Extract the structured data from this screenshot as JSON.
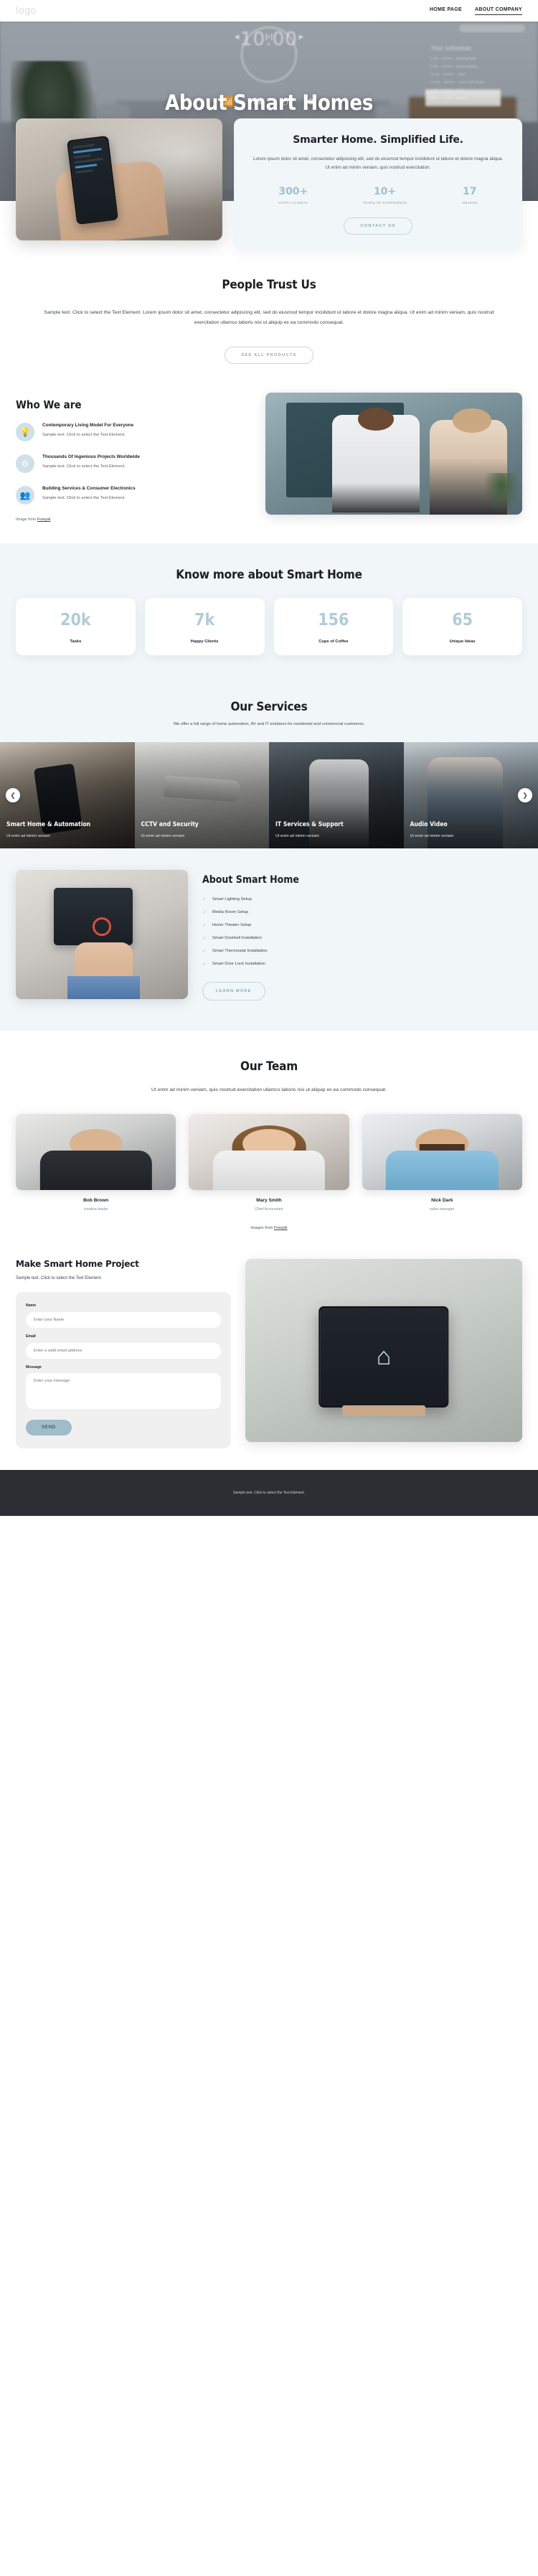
{
  "header": {
    "logo": "logo",
    "nav": [
      {
        "label": "HOME PAGE",
        "active": false
      },
      {
        "label": "ABOUT COMPANY",
        "active": true
      }
    ]
  },
  "hero": {
    "title": "About Smart Homes",
    "overlay_time": "10:00",
    "schedule_title": "Your schedule",
    "schedule": [
      {
        "time": "8 AM",
        "task": "Morning Walk"
      },
      {
        "time": "9 AM",
        "task": "Board Meeting"
      },
      {
        "time": "11 AM",
        "task": "Work"
      },
      {
        "time": "12 PM",
        "task": "Lunch with Family"
      },
      {
        "time": "2 PM",
        "task": "Work"
      },
      {
        "time": "5 PM",
        "task": "Dinner"
      }
    ],
    "phone_time": "10:00",
    "phone_labels": [
      "Wi-Fi",
      "Bluetooth"
    ],
    "controls": [
      "prev-icon",
      "pause-icon",
      "play-icon"
    ],
    "status_icons": [
      "wifi-icon",
      "bluetooth-icon",
      "power-icon",
      "settings-icon"
    ]
  },
  "hero_card": {
    "title": "Smarter Home. Simplified Life.",
    "description": "Lorem ipsum dolor sit amet, consectetur adipiscing elit, sed do eiusmod tempor incididunt ut labore et dolore magna aliqua. Ut enim ad minim veniam, quis nostrud exercitation.",
    "stats": [
      {
        "number": "300+",
        "label": "HAPPY CLIENTS"
      },
      {
        "number": "10+",
        "label": "YEARS OF EXPERIENCE"
      },
      {
        "number": "17",
        "label": "AWARDS"
      }
    ],
    "button": "CONTACT US"
  },
  "trust": {
    "title": "People Trust Us",
    "text": "Sample text. Click to select the Text Element. Lorem ipsum dolor sit amet, consectetur adipiscing elit, sed do eiusmod tempor incididunt ut labore et dolore magna aliqua. Ut enim ad minim veniam, quis nostrud exercitation ullamco laboris nisi ut aliquip ex ea commodo consequat.",
    "button": "SEE ALL PRODUCTS"
  },
  "who": {
    "title": "Who We are",
    "features": [
      {
        "icon": "lightbulb-icon",
        "title": "Contemporary Living Model For Everyone",
        "desc": "Sample text. Click to select the Text Element."
      },
      {
        "icon": "gear-icon",
        "title": "Thousands Of Ingenious Projects Worldwide",
        "desc": "Sample text. Click to select the Text Element."
      },
      {
        "icon": "people-icon",
        "title": "Building Services & Consumer Electronics",
        "desc": "Sample text. Click to select the Text Element."
      }
    ],
    "credit_prefix": "Image from ",
    "credit_link": "Freepik"
  },
  "know_more": {
    "title": "Know more about Smart Home",
    "stats": [
      {
        "number": "20k",
        "label": "Tasks"
      },
      {
        "number": "7k",
        "label": "Happy Clients"
      },
      {
        "number": "156",
        "label": "Cups of Coffee"
      },
      {
        "number": "65",
        "label": "Unique Ideas"
      }
    ]
  },
  "services": {
    "title": "Our Services",
    "subtitle": "We offer a full range of home automation, AV and IT solutions for residential and commercial customers.",
    "prev_icon": "chevron-left-icon",
    "next_icon": "chevron-right-icon",
    "items": [
      {
        "title": "Smart Home & Automation",
        "desc": "Ut enim ad minim veniam"
      },
      {
        "title": "CCTV and Security",
        "desc": "Ut enim ad minim veniam"
      },
      {
        "title": "IT Services & Support",
        "desc": "Ut enim ad minim veniam"
      },
      {
        "title": "Audio Video",
        "desc": "Ut enim ad minim veniam"
      }
    ]
  },
  "about_smart_home": {
    "title": "About Smart Home",
    "items": [
      "Smart Lighting Setup",
      "Media Room Setup",
      "Home Theater Setup",
      "Smart Doorbell Installation",
      "Smart Thermostat Installation",
      "Smart Door Lock Installation"
    ],
    "button": "LEARN MORE"
  },
  "team": {
    "title": "Our Team",
    "subtitle": "Ut enim ad minim veniam, quis nostrud exercitation ullamco laboris nisi ut aliquip ex ea commodo consequat.",
    "members": [
      {
        "name": "Bob Brown",
        "role": "creative leader"
      },
      {
        "name": "Mary Smith",
        "role": "Chief Accountant"
      },
      {
        "name": "Nick Dark",
        "role": "sales manager"
      }
    ],
    "credit_prefix": "Images from ",
    "credit_link": "Freepik"
  },
  "contact": {
    "title": "Make Smart Home Project",
    "subtitle": "Sample text. Click to select the Text Element.",
    "fields": {
      "name_label": "Name",
      "name_placeholder": "Enter your Name",
      "email_label": "Email",
      "email_placeholder": "Enter a valid email address",
      "message_label": "Message",
      "message_placeholder": "Enter your message"
    },
    "submit": "SEND"
  },
  "footer": {
    "text": "Sample text. Click to select the Text Element."
  },
  "colors": {
    "accent": "#9fbccb",
    "tint_bg": "#f1f6f8",
    "stat_number": "#b1cbd8",
    "dark": "#2b2f33"
  }
}
